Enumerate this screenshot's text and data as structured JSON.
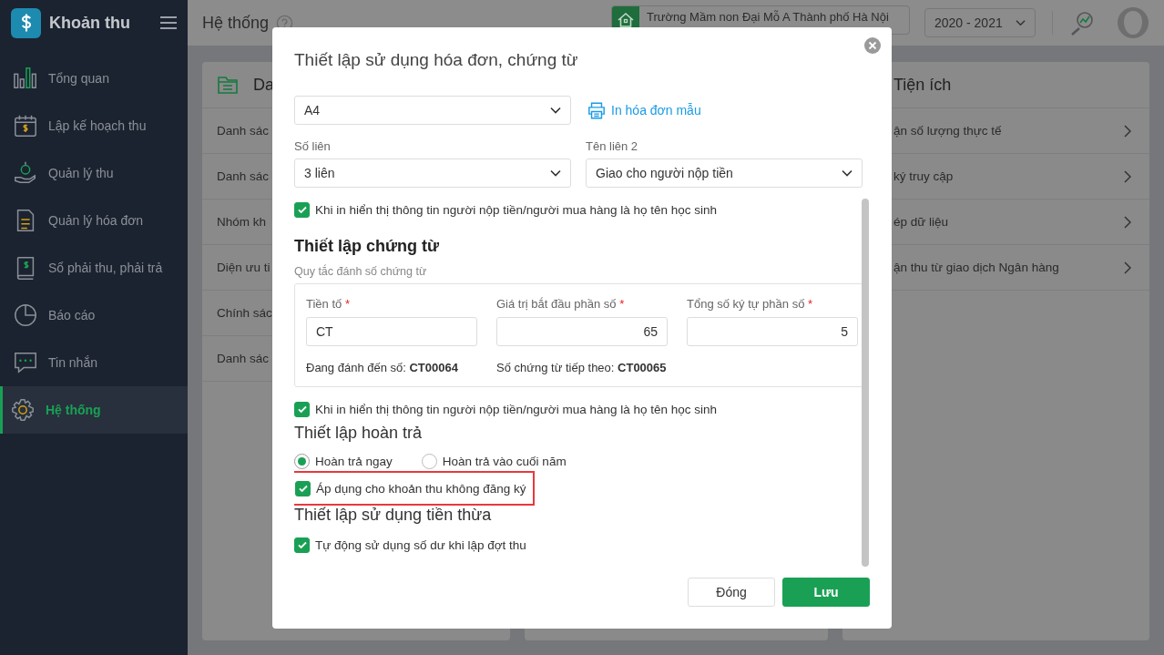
{
  "sidebar": {
    "app_title": "Khoản thu",
    "items": [
      {
        "label": "Tổng quan",
        "kind": "chart",
        "selected": false
      },
      {
        "label": "Lập kế hoạch thu",
        "kind": "calendar",
        "selected": false
      },
      {
        "label": "Quản lý thu",
        "kind": "hand",
        "selected": false
      },
      {
        "label": "Quản lý hóa đơn",
        "kind": "document",
        "selected": false
      },
      {
        "label": "Sổ phải thu, phải trả",
        "kind": "book",
        "selected": false
      },
      {
        "label": "Báo cáo",
        "kind": "pie",
        "selected": false
      },
      {
        "label": "Tin nhắn",
        "kind": "message",
        "selected": false
      },
      {
        "label": "Hệ thống",
        "kind": "gear",
        "selected": true
      }
    ]
  },
  "topbar": {
    "title": "Hệ thống",
    "school": "Trường Mầm non Đại Mỗ A Thành phố Hà Nội",
    "year": "2020 - 2021"
  },
  "left_card": {
    "title": "Da",
    "items": [
      "Danh sác",
      "Danh sác",
      "Nhóm kh",
      "Diện ưu ti",
      "Chính sác",
      "Danh sác"
    ]
  },
  "right_card": {
    "title": "Tiện ích",
    "items": [
      "ận số lượng thực tế",
      "ký truy cập",
      "ép dữ liệu",
      "ận thu từ giao dịch Ngân hàng"
    ]
  },
  "dialog": {
    "title": "Thiết lập sử dụng hóa đơn, chứng từ",
    "paper_size": "A4",
    "print_sample_link": "In hóa đơn mẫu",
    "copies": {
      "label": "Số liên",
      "value": "3 liên"
    },
    "copy2_name": {
      "label": "Tên liên 2",
      "value": "Giao cho người nộp tiền"
    },
    "invoice_payer_option": {
      "label": "Khi in hiển thị thông tin người nộp tiền/người mua hàng là họ tên học sinh",
      "checked": true
    },
    "voucher_section": {
      "title": "Thiết lập chứng từ",
      "subtitle": "Quy tắc đánh số chứng từ",
      "fields": [
        {
          "label": "Tiền tố",
          "mark": "*",
          "value": "CT",
          "kind": "text"
        },
        {
          "label": "Giá trị bắt đầu phần số",
          "mark": "*",
          "value": "65",
          "kind": "number"
        },
        {
          "label": "Tổng số ký tự phần số",
          "mark": "*",
          "value": "5",
          "kind": "number"
        }
      ],
      "current": "Đang đánh đến số: **CT00064**",
      "next": "Số chứng từ tiếp theo: **CT00065**"
    },
    "voucher_payer_option": {
      "label": "Khi in hiển thị thông tin người nộp tiền/người mua hàng là họ tên học sinh",
      "checked": true
    },
    "refund_section": {
      "title": "Thiết lập hoàn trả",
      "options": [
        {
          "label": "Hoàn trả ngay",
          "selected": true
        },
        {
          "label": "Hoàn trả vào cuối năm",
          "selected": false
        }
      ],
      "apply_unregistered": {
        "label": "Áp dụng cho khoản thu không đăng ký",
        "checked": true,
        "highlighted": true
      }
    },
    "excess_section": {
      "title": "Thiết lập sử dụng tiền thừa",
      "auto_use": {
        "label": "Tự động sử dụng số dư khi lập đợt thu",
        "checked": true
      }
    },
    "buttons": [
      {
        "label": "Đóng",
        "kind": "secondary"
      },
      {
        "label": "Lưu",
        "kind": "primary"
      }
    ]
  }
}
